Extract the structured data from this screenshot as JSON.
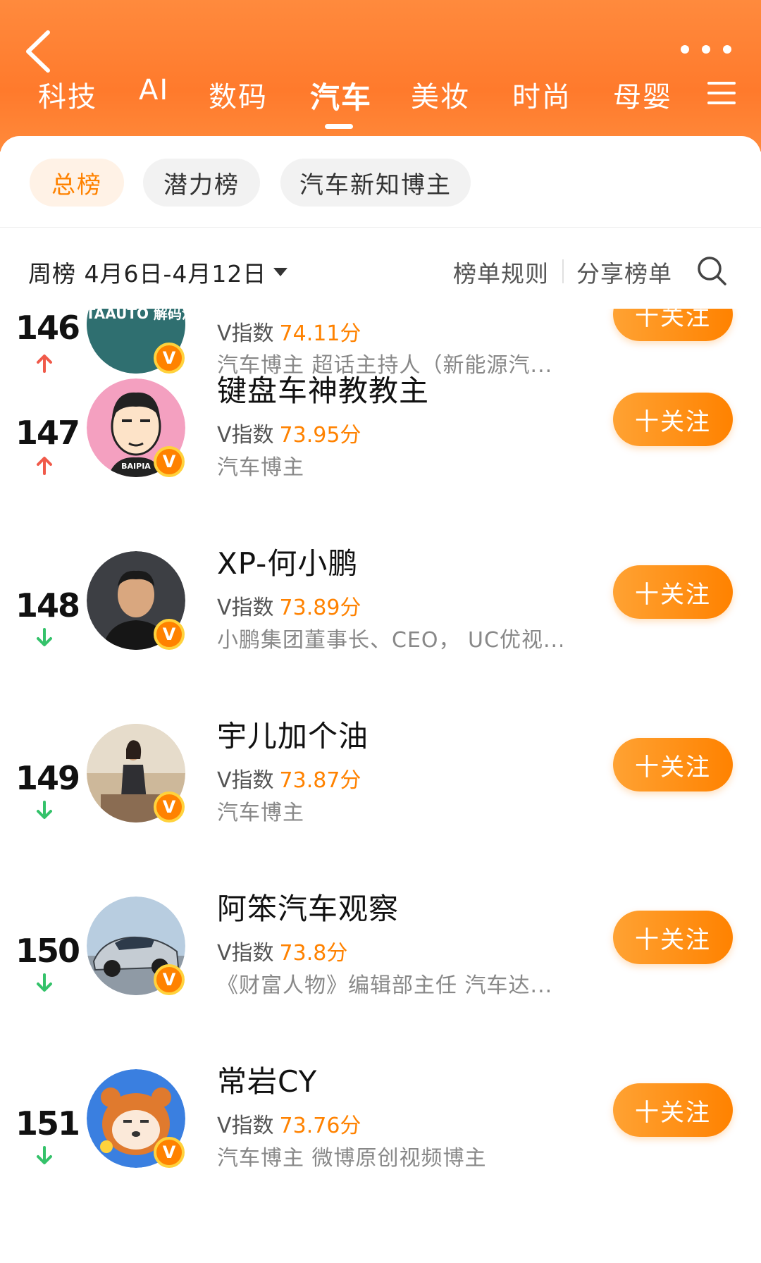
{
  "header": {
    "tabs": [
      "科技",
      "AI",
      "数码",
      "汽车",
      "美妆",
      "时尚",
      "母婴"
    ],
    "active_tab": "汽车"
  },
  "subtabs": [
    "总榜",
    "潜力榜",
    "汽车新知博主"
  ],
  "period_label": "周榜 4月6日-4月12日",
  "rules_label": "榜单规则",
  "share_label": "分享榜单",
  "score_prefix": "V指数",
  "follow_label": "十关注",
  "rows": [
    {
      "rank": "146",
      "trend": "up",
      "name": "",
      "score": "74.11分",
      "desc": "汽车博主 超话主持人（新能源汽...",
      "avatar_text": "METAAUTO 解码汽车"
    },
    {
      "rank": "147",
      "trend": "up",
      "name": "键盘车神教教主",
      "score": "73.95分",
      "desc": "汽车博主",
      "avatar_text": "BAIPIA"
    },
    {
      "rank": "148",
      "trend": "down",
      "name": "XP-何小鹏",
      "score": "73.89分",
      "desc": "小鹏集团董事长、CEO， UC优视...",
      "avatar_text": ""
    },
    {
      "rank": "149",
      "trend": "down",
      "name": "宇儿加个油",
      "score": "73.87分",
      "desc": "汽车博主",
      "avatar_text": ""
    },
    {
      "rank": "150",
      "trend": "down",
      "name": "阿笨汽车观察",
      "score": "73.8分",
      "desc": "《财富人物》编辑部主任 汽车达...",
      "avatar_text": ""
    },
    {
      "rank": "151",
      "trend": "down",
      "name": "常岩CY",
      "score": "73.76分",
      "desc": "汽车博主 微博原创视频博主",
      "avatar_text": ""
    }
  ],
  "colors": {
    "accent": "#ff8200",
    "header_bg": "#ff7a2c",
    "up": "#f05a4a",
    "down": "#34c26a"
  }
}
